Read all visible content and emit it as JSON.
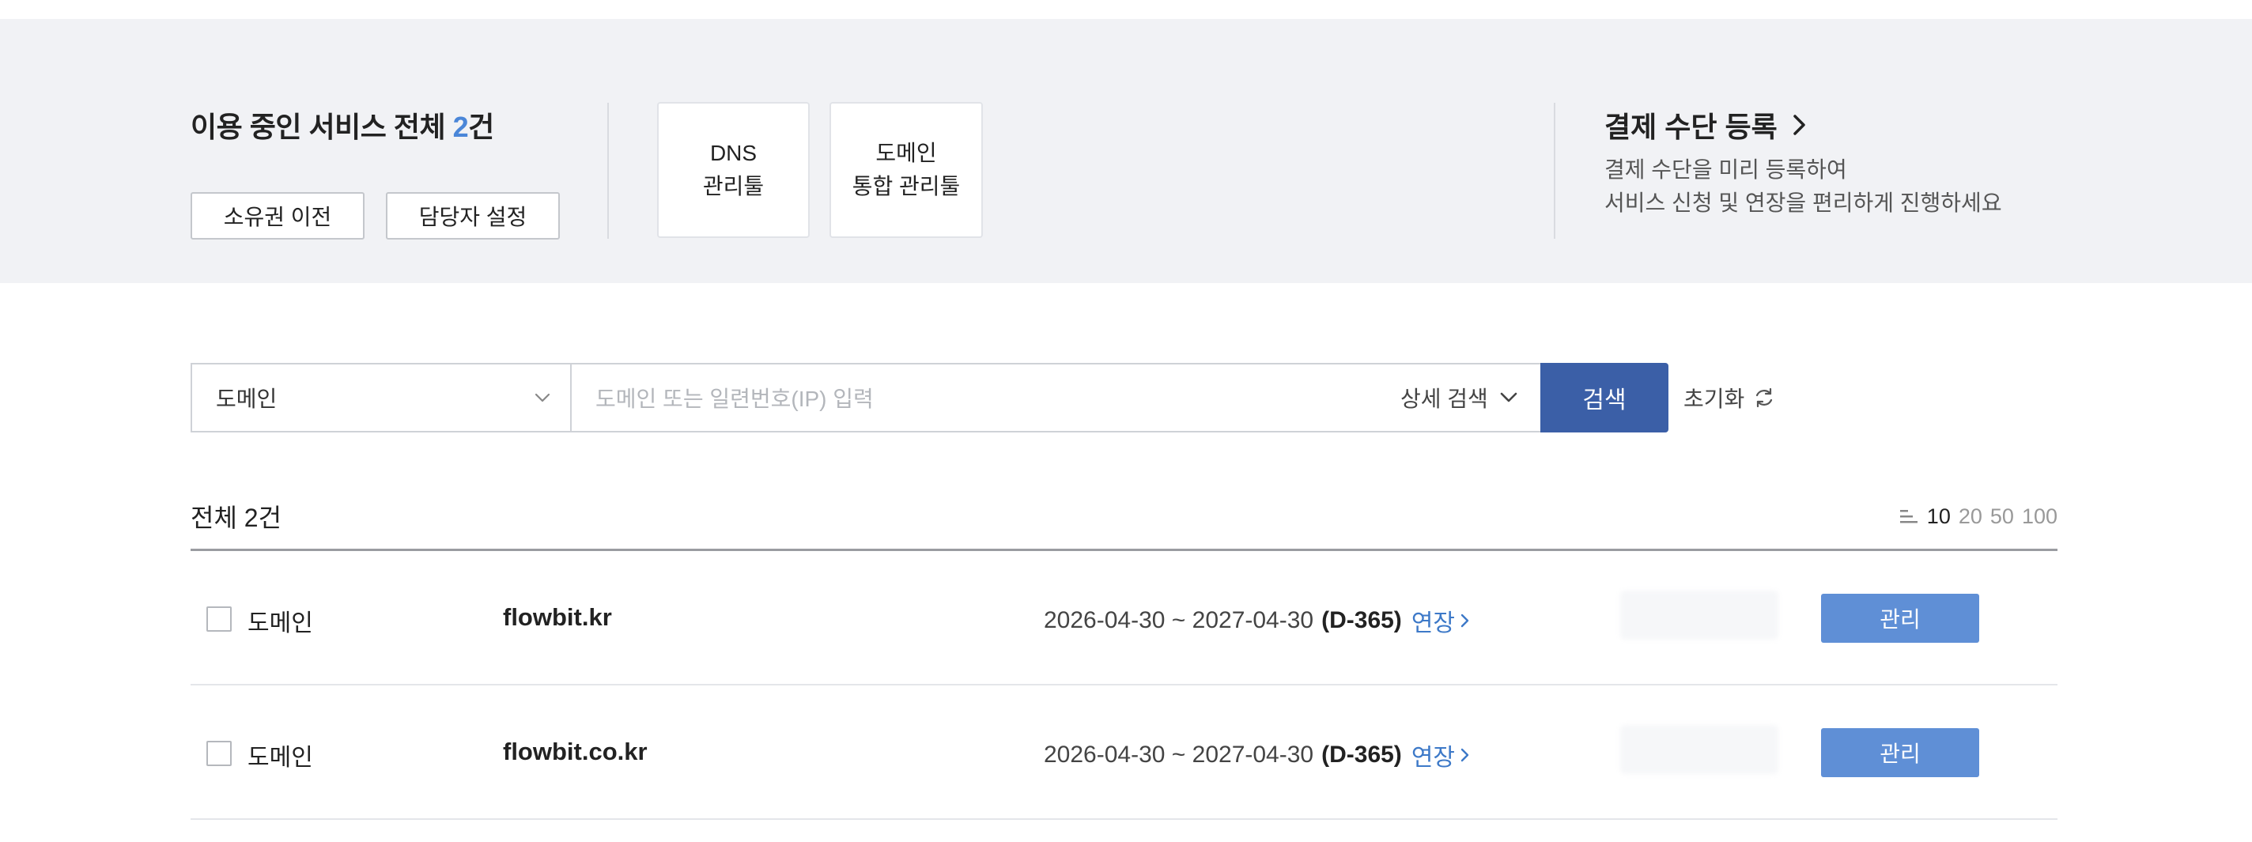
{
  "summary": {
    "service_title_prefix": "이용 중인 서비스 전체 ",
    "service_count": "2",
    "service_title_suffix": "건",
    "transfer_button": "소유권 이전",
    "manager_button": "담당자 설정",
    "dns_card": [
      "DNS",
      "관리툴"
    ],
    "domain_card": [
      "도메인",
      "통합 관리툴"
    ],
    "payment_title": "결제 수단 등록",
    "payment_desc": [
      "결제 수단을 미리 등록하여",
      "서비스 신청 및 연장을 편리하게 진행하세요"
    ]
  },
  "search": {
    "category_selected": "도메인",
    "placeholder": "도메인 또는 일련번호(IP) 입력",
    "value": "",
    "advanced_label": "상세 검색",
    "button_label": "검색",
    "reset_label": "초기화"
  },
  "list": {
    "total_label": "전체 2건",
    "page_sizes": [
      "10",
      "20",
      "50",
      "100"
    ],
    "active_page_size": "10",
    "rows": [
      {
        "type": "도메인",
        "domain": "flowbit.kr",
        "period": "2026-04-30 ~ 2027-04-30",
        "dday": "(D-365)",
        "renew_label": "연장",
        "manage_label": "관리"
      },
      {
        "type": "도메인",
        "domain": "flowbit.co.kr",
        "period": "2026-04-30 ~ 2027-04-30",
        "dday": "(D-365)",
        "renew_label": "연장",
        "manage_label": "관리"
      }
    ]
  },
  "colors": {
    "panel_bg": "#f1f2f5",
    "accent_count": "#4a86d8",
    "search_button": "#3b5fa7",
    "manage_button": "#5f8fd6",
    "renew_link": "#3d79c8"
  },
  "icons": {
    "payment": "chevron-right-icon",
    "category": "chevron-down-icon",
    "advanced": "chevron-down-icon",
    "reset": "refresh-icon",
    "page_size": "list-lines-icon",
    "renew": "chevron-right-icon"
  }
}
